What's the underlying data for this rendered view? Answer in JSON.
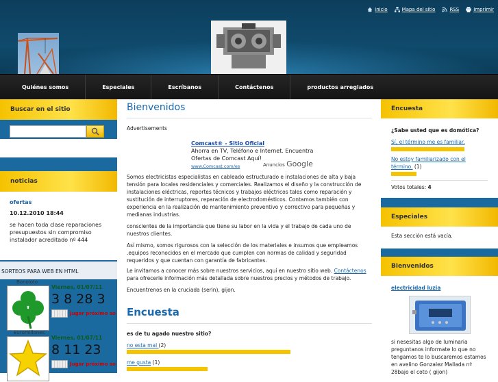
{
  "header": {
    "top_links": [
      {
        "label": "Inicio",
        "icon": "home-icon"
      },
      {
        "label": "Mapa del sitio",
        "icon": "sitemap-icon"
      },
      {
        "label": "RSS",
        "icon": "rss-icon"
      },
      {
        "label": "Imprimir",
        "icon": "print-icon"
      }
    ]
  },
  "nav": {
    "items": [
      "Quiénes somos",
      "Especiales",
      "Escríbanos",
      "Contáctenos",
      "productos arreglados"
    ]
  },
  "left": {
    "search_title": "Buscar en el sitio",
    "news_title": "noticias",
    "news_link": "ofertas",
    "news_date": "10.12.2010 18:44",
    "news_text": "se hacen toda clase reparaciones presupuestos sin compromiso instalador acreditado nº 444",
    "sorteos_title": "SORTEOS PARA WEB EN HTML",
    "lotteries": [
      {
        "name": "Bonoloto",
        "date": "Viernes, 01/07/11",
        "numbers": "3  8  28  3",
        "play": "Jugar próximo so"
      },
      {
        "name": "Euromillones",
        "date": "Viernes, 01/07/11",
        "numbers": "8  11  23",
        "play": "Jugar próximo so"
      }
    ]
  },
  "center": {
    "title": "Bienvenidos",
    "advertisements": "Advertisements",
    "ad": {
      "title": "Comcast® - Sitio Oficial",
      "line1": "Ahorra en TV, Teléfono e Internet. Encuentra",
      "line2": "Ofertas de Comcast Aquí!",
      "url": "www.Comcast.com/es",
      "by": "Anuncios",
      "brand": "Google"
    },
    "p1": "Somos electricistas especialistas en cableado estructurado e instalaciones de alta y baja tensión para locales residenciales y comerciales. Realizamos el diseño y la construcción de instalaciones eléctricas, reportes técnicos y trabajos eléctricos tales como reparación y sustitución de interruptores, reparación de electrodomésticos. Contamos también con experiencia en la realización de mantenimiento preventivo y correctivo para pequeñas y medianas industrias.",
    "p2": " conscientes de la importancia que tiene su labor en la vida y el trabajo de cada uno de nuestros clientes.",
    "p3": "Así mismo, somos rigurosos con la selección de los materiales e insumos que empleamos .equipos reconocidos en el mercado que cumplen con normas de calidad y seguridad requeridos y que cuentan con garantía de fabricantes.",
    "p4_before": "Le invitamos a conocer más sobre nuestros servicios, aquí en nuestro sitio web. ",
    "p4_link": "Contáctenos",
    "p4_after": " para ofrecerle información más detallada sobre nuestros precios y métodos de trabajo.",
    "p5": "Encuentrenos en la cruciada (serin), gijon.",
    "poll_title": "Encuesta",
    "poll_question": "es de tu agado nuestro sitio?",
    "poll_options": [
      {
        "label": "no esta mal ",
        "count": "(2)",
        "share": 0.67
      },
      {
        "label": "me gusta",
        "count": " (1)",
        "share": 0.33
      }
    ]
  },
  "right": {
    "poll_title": "Encuesta",
    "poll_question": "¿Sabe usted que es domótica?",
    "poll_options": [
      {
        "label": "Sí, el término me es familiar.",
        "count": "",
        "share": 1.0
      },
      {
        "label": "No estoy familiarizado con el término.",
        "count": " (1)",
        "share": 0.35
      }
    ],
    "total_label": "Votos totales: ",
    "total_value": "4",
    "especiales_title": "Especiales",
    "especiales_text": "Esta sección está vacía.",
    "bienvenidos_title": "Bienvenidos",
    "bienvenidos_link": "electricidad luzia",
    "bienvenidos_text": "si nesesitas algo de luminaria preguntanos informate  lo que no tengamos te lo buscaremos  estamos en avelino Gonzalez Mallada  nº 28bajo  el coto  ( gijon)"
  }
}
